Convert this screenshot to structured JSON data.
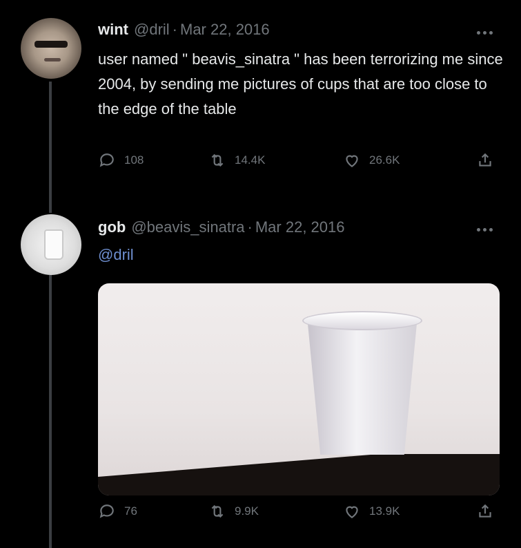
{
  "tweets": [
    {
      "display_name": "wint",
      "handle": "@dril",
      "separator": "·",
      "date": "Mar 22, 2016",
      "text": "user named \" beavis_sinatra \" has been terrorizing me since 2004, by sending me pictures of cups that are too close to the edge of the table",
      "replies": "108",
      "retweets": "14.4K",
      "likes": "26.6K"
    },
    {
      "display_name": "gob",
      "handle": "@beavis_sinatra",
      "separator": "·",
      "date": "Mar 22, 2016",
      "reply_to": "@dril",
      "replies": "76",
      "retweets": "9.9K",
      "likes": "13.9K"
    }
  ],
  "icons": {
    "reply": "speech-bubble-icon",
    "retweet": "retweet-arrows-icon",
    "like": "heart-icon",
    "share": "share-icon",
    "more": "ellipsis-icon"
  },
  "colors": {
    "background": "#000000",
    "text": "#e7e9ea",
    "muted": "#71767b",
    "link": "#6e8fd0",
    "thread_line": "#3b3e42"
  }
}
